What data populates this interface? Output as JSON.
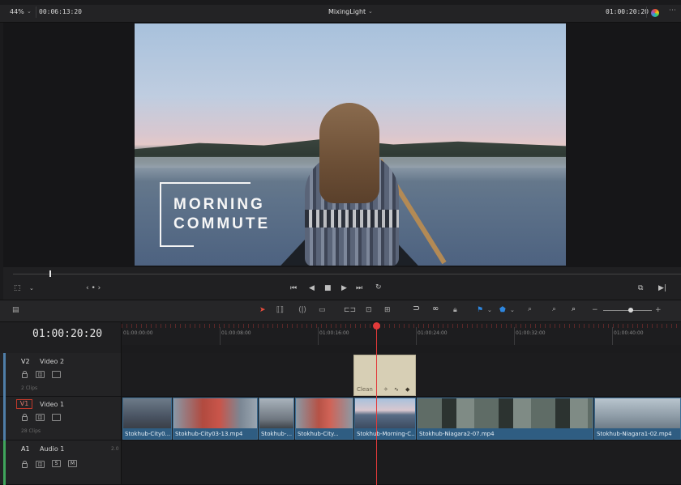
{
  "header": {
    "zoom": "44%",
    "source_timecode": "00:06:13:20",
    "project_name": "MixingLight",
    "record_timecode": "01:00:20:20"
  },
  "viewer": {
    "title_line1": "MORNING",
    "title_line2": "COMMUTE"
  },
  "timeline": {
    "timecode": "01:00:20:20",
    "ruler_ticks": [
      "01:00:00:00",
      "01:00:08:00",
      "01:00:16:00",
      "01:00:24:00",
      "01:00:32:00",
      "01:00:40:00"
    ],
    "tracks": {
      "v2": {
        "id": "V2",
        "name": "Video 2",
        "count": "2 Clips"
      },
      "v1": {
        "id": "V1",
        "name": "Video 1",
        "count": "28 Clips"
      },
      "a1": {
        "id": "A1",
        "name": "Audio 1",
        "channels": "2.0",
        "solo": "S",
        "mute": "M"
      }
    },
    "title_clip": {
      "label": "Clean"
    },
    "clips": [
      {
        "label": "Stokhub-City0..."
      },
      {
        "label": "Stokhub-City03-13.mp4"
      },
      {
        "label": "Stokhub-..."
      },
      {
        "label": "Stokhub-City..."
      },
      {
        "label": "Stokhub-Morning-C..."
      },
      {
        "label": "Stokhub-Niagara2-07.mp4"
      },
      {
        "label": "Stokhub-Niagara1-02.mp4"
      }
    ]
  },
  "icons": {
    "transport": [
      "skip-back-icon",
      "step-back-icon",
      "stop-icon",
      "play-icon",
      "skip-forward-icon",
      "loop-icon"
    ],
    "accent": "#e23a3a",
    "clip_color": "#2f5d82",
    "title_clip_color": "#d7cfb5"
  }
}
